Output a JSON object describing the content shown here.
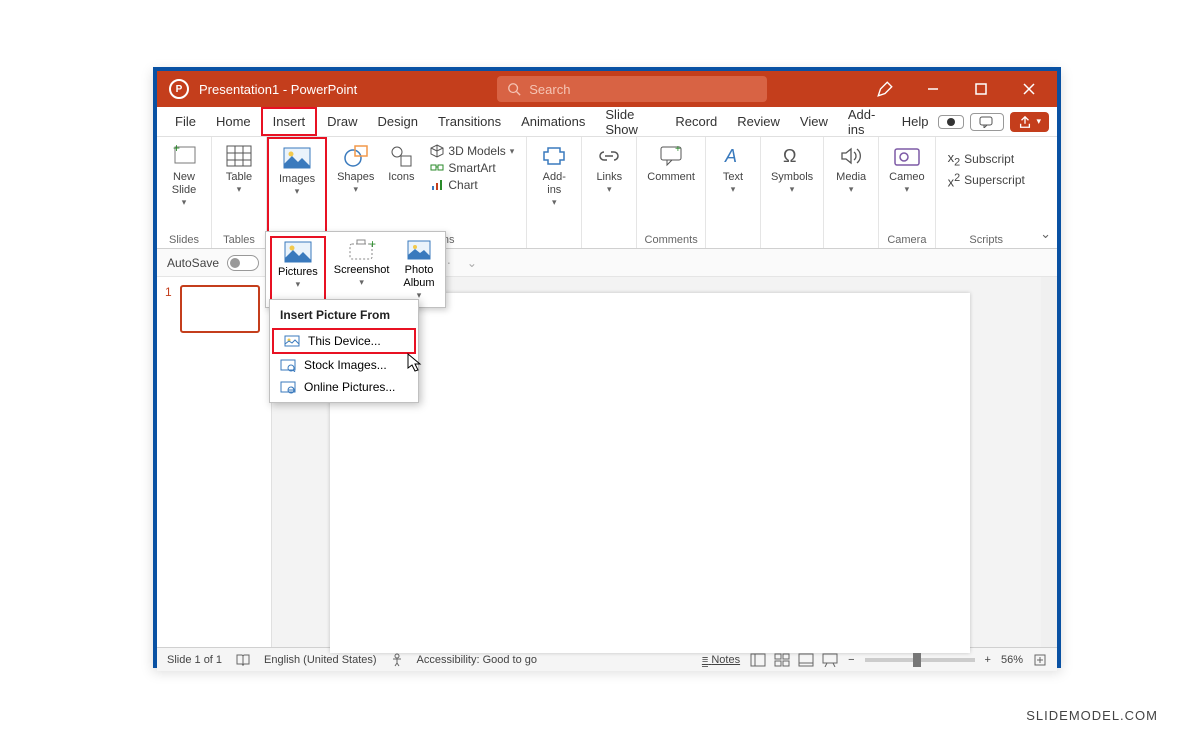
{
  "titlebar": {
    "title": "Presentation1 - PowerPoint",
    "search_placeholder": "Search"
  },
  "menu": {
    "items": [
      "File",
      "Home",
      "Insert",
      "Draw",
      "Design",
      "Transitions",
      "Animations",
      "Slide Show",
      "Record",
      "Review",
      "View",
      "Add-ins",
      "Help"
    ],
    "active": "Insert"
  },
  "ribbon": {
    "slides": {
      "new_slide": "New\nSlide",
      "label": "Slides"
    },
    "tables": {
      "table": "Table",
      "label": "Tables"
    },
    "images": {
      "images": "Images"
    },
    "illustrations": {
      "shapes": "Shapes",
      "icons": "Icons",
      "models": "3D Models",
      "smartart": "SmartArt",
      "chart": "Chart",
      "label": "Illustrations"
    },
    "addins": {
      "label": "Add-\nins"
    },
    "links": {
      "label": "Links"
    },
    "comment": {
      "btn": "Comment",
      "label": "Comments"
    },
    "text": {
      "label": "Text"
    },
    "symbols": {
      "label": "Symbols"
    },
    "media": {
      "label": "Media"
    },
    "cameo": {
      "btn": "Cameo",
      "label": "Camera"
    },
    "scripts": {
      "sub": "Subscript",
      "sup": "Superscript",
      "label": "Scripts"
    }
  },
  "sub_ribbon": {
    "pictures": "Pictures",
    "screenshot": "Screenshot",
    "photo_album": "Photo\nAlbum"
  },
  "dropdown": {
    "header": "Insert Picture From",
    "this_device": "This Device...",
    "stock": "Stock Images...",
    "online": "Online Pictures..."
  },
  "autosave": {
    "label": "AutoSave",
    "state": "Off"
  },
  "slide_panel": {
    "num": "1"
  },
  "statusbar": {
    "slide": "Slide 1 of 1",
    "lang": "English (United States)",
    "access": "Accessibility: Good to go",
    "notes": "Notes",
    "zoom": "56%"
  },
  "watermark": "SLIDEMODEL.COM"
}
